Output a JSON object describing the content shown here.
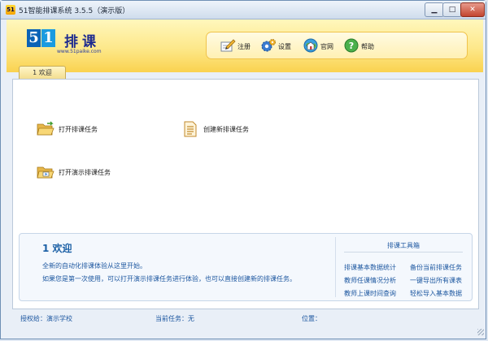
{
  "window": {
    "title": "51智能排课系统 3.5.5（演示版）",
    "app_icon_text": "51",
    "controls": {
      "minimize": "▁",
      "maximize": "□",
      "close": "✕"
    }
  },
  "logo": {
    "digit1": "5",
    "digit2": "1",
    "cn": "排课",
    "url": "www.51paike.com"
  },
  "toolbar": {
    "register": {
      "label": "注册",
      "icon": "pencil-paper-icon"
    },
    "settings": {
      "label": "设置",
      "icon": "gear-icon"
    },
    "website": {
      "label": "官网",
      "icon": "globe-home-icon"
    },
    "help": {
      "label": "帮助",
      "icon": "help-icon"
    }
  },
  "tabs": [
    {
      "label": "1 欢迎",
      "active": true
    }
  ],
  "actions": {
    "open_task": {
      "label": "打开排课任务",
      "icon": "folder-open-icon"
    },
    "create_task": {
      "label": "创建新排课任务",
      "icon": "document-icon"
    },
    "open_demo": {
      "label": "打开演示排课任务",
      "icon": "folder-demo-icon"
    }
  },
  "welcome": {
    "title": "1 欢迎",
    "line1": "全新的自动化排课体验从这里开始。",
    "line2": "如果您是第一次使用，可以打开演示排课任务进行体验，也可以直接创建新的排课任务。"
  },
  "tools_box": {
    "title": "排课工具箱",
    "links": [
      "排课基本数据统计",
      "备份当前排课任务",
      "教师任课情况分析",
      "一键导出所有课表",
      "教师上课时间查询",
      "轻松导入基本数据"
    ]
  },
  "status": {
    "school": "授权给：演示学校",
    "task": "当前任务：无",
    "position": "位置："
  },
  "colors": {
    "header_top": "#fff7bd",
    "header_bottom": "#fad24f",
    "link_blue": "#1d57a0",
    "logo_blue": "#0b63b6"
  }
}
